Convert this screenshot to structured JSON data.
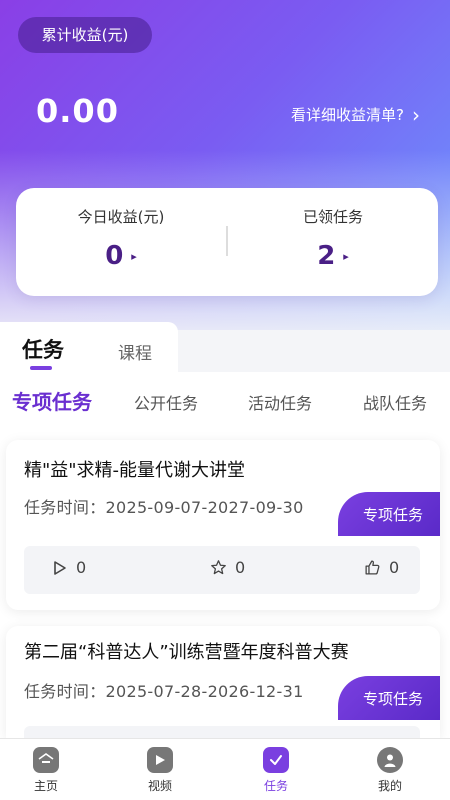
{
  "header": {
    "total_label": "累计收益(元)",
    "total_value": "0.00",
    "detail_link": "看详细收益清单?",
    "detail_chevron": "›"
  },
  "stats": {
    "today_label": "今日收益(元)",
    "today_value": "0",
    "claimed_label": "已领任务",
    "claimed_value": "2",
    "arrow": "▸"
  },
  "tabs": {
    "task": "任务",
    "course": "课程"
  },
  "sub_tabs": [
    "专项任务",
    "公开任务",
    "活动任务",
    "战队任务"
  ],
  "tasks": [
    {
      "title": "精\"益\"求精-能量代谢大讲堂",
      "time_label": "任务时间：",
      "time": "2025-09-07-2027-09-30",
      "badge": "专项任务",
      "views": "0",
      "stars": "0",
      "likes": "0"
    },
    {
      "title": "第二届“科普达人”训练营暨年度科普大赛",
      "time_label": "任务时间：",
      "time": "2025-07-28-2026-12-31",
      "badge": "专项任务"
    }
  ],
  "nav": [
    {
      "label": "主页",
      "icon": "home-icon"
    },
    {
      "label": "视频",
      "icon": "video-icon"
    },
    {
      "label": "任务",
      "icon": "calendar-check-icon",
      "active": true
    },
    {
      "label": "我的",
      "icon": "profile-icon"
    }
  ],
  "colors": {
    "accent": "#7a3fe0",
    "gradient_start": "#8a3fe6",
    "gradient_end": "#6b9bff"
  }
}
